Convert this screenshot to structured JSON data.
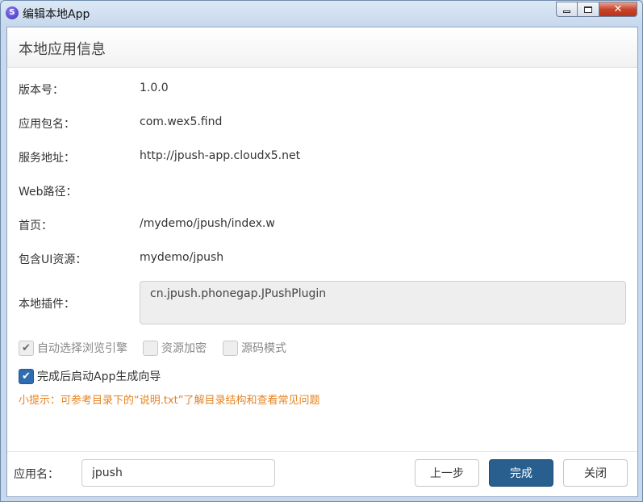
{
  "window": {
    "title": "编辑本地App",
    "icon": "s-logo-icon",
    "controls": {
      "minimize": "minimize-icon",
      "maximize": "maximize-icon",
      "close_glyph": "✕"
    }
  },
  "header": {
    "title": "本地应用信息"
  },
  "fields": {
    "version": {
      "label": "版本号：",
      "value": "1.0.0"
    },
    "package": {
      "label": "应用包名：",
      "value": "com.wex5.find"
    },
    "service": {
      "label": "服务地址：",
      "value": "http://jpush-app.cloudx5.net"
    },
    "web_path": {
      "label": "Web路径：",
      "value": ""
    },
    "home": {
      "label": "首页：",
      "value": "/mydemo/jpush/index.w"
    },
    "ui_res": {
      "label": "包含UI资源：",
      "value": "mydemo/jpush"
    },
    "plugins": {
      "label": "本地插件：",
      "value": "cn.jpush.phonegap.JPushPlugin"
    }
  },
  "options": [
    {
      "label": "自动选择浏览引擎",
      "checked": true,
      "enabled": false,
      "mark": "✔"
    },
    {
      "label": "资源加密",
      "checked": false,
      "enabled": false,
      "mark": ""
    },
    {
      "label": "源码模式",
      "checked": false,
      "enabled": false,
      "mark": ""
    },
    {
      "label": "完成后启动App生成向导",
      "checked": true,
      "enabled": true,
      "mark": "✔"
    }
  ],
  "hint": "小提示：可参考目录下的“说明.txt”了解目录结构和查看常见问题",
  "footer": {
    "name_label": "应用名：",
    "name_value": "jpush",
    "prev_label": "上一步",
    "finish_label": "完成",
    "close_label": "关闭"
  },
  "colors": {
    "primary": "#285f8f",
    "hint": "#e6821f",
    "checkbox_active": "#2e6db0"
  }
}
